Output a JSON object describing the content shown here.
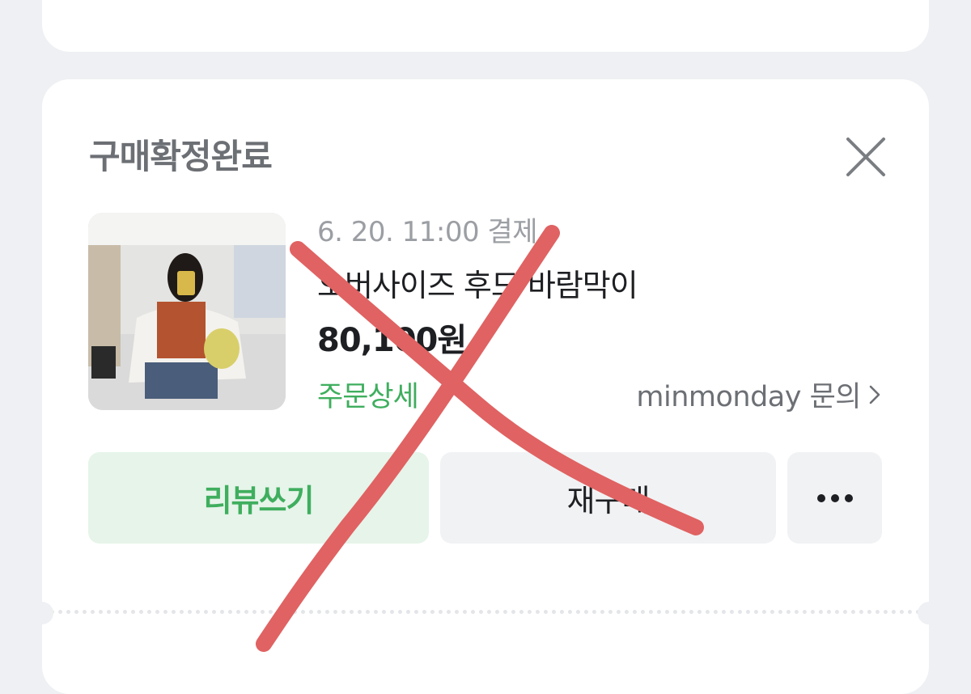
{
  "order": {
    "status_title": "구매확정완료",
    "date": "6. 20. 11:00 결제",
    "product_name": "오버사이즈 후드 바람막이",
    "price": "80,100원",
    "order_detail_link": "주문상세",
    "seller_inquiry": "minmonday 문의"
  },
  "actions": {
    "review": "리뷰쓰기",
    "rebuy": "재구매",
    "more_icon": "more-dots-icon"
  },
  "icons": {
    "close": "close-icon",
    "chevron": "chevron-right-icon"
  },
  "colors": {
    "accent_green": "#3fae5e",
    "overlay_red": "#e06262"
  }
}
